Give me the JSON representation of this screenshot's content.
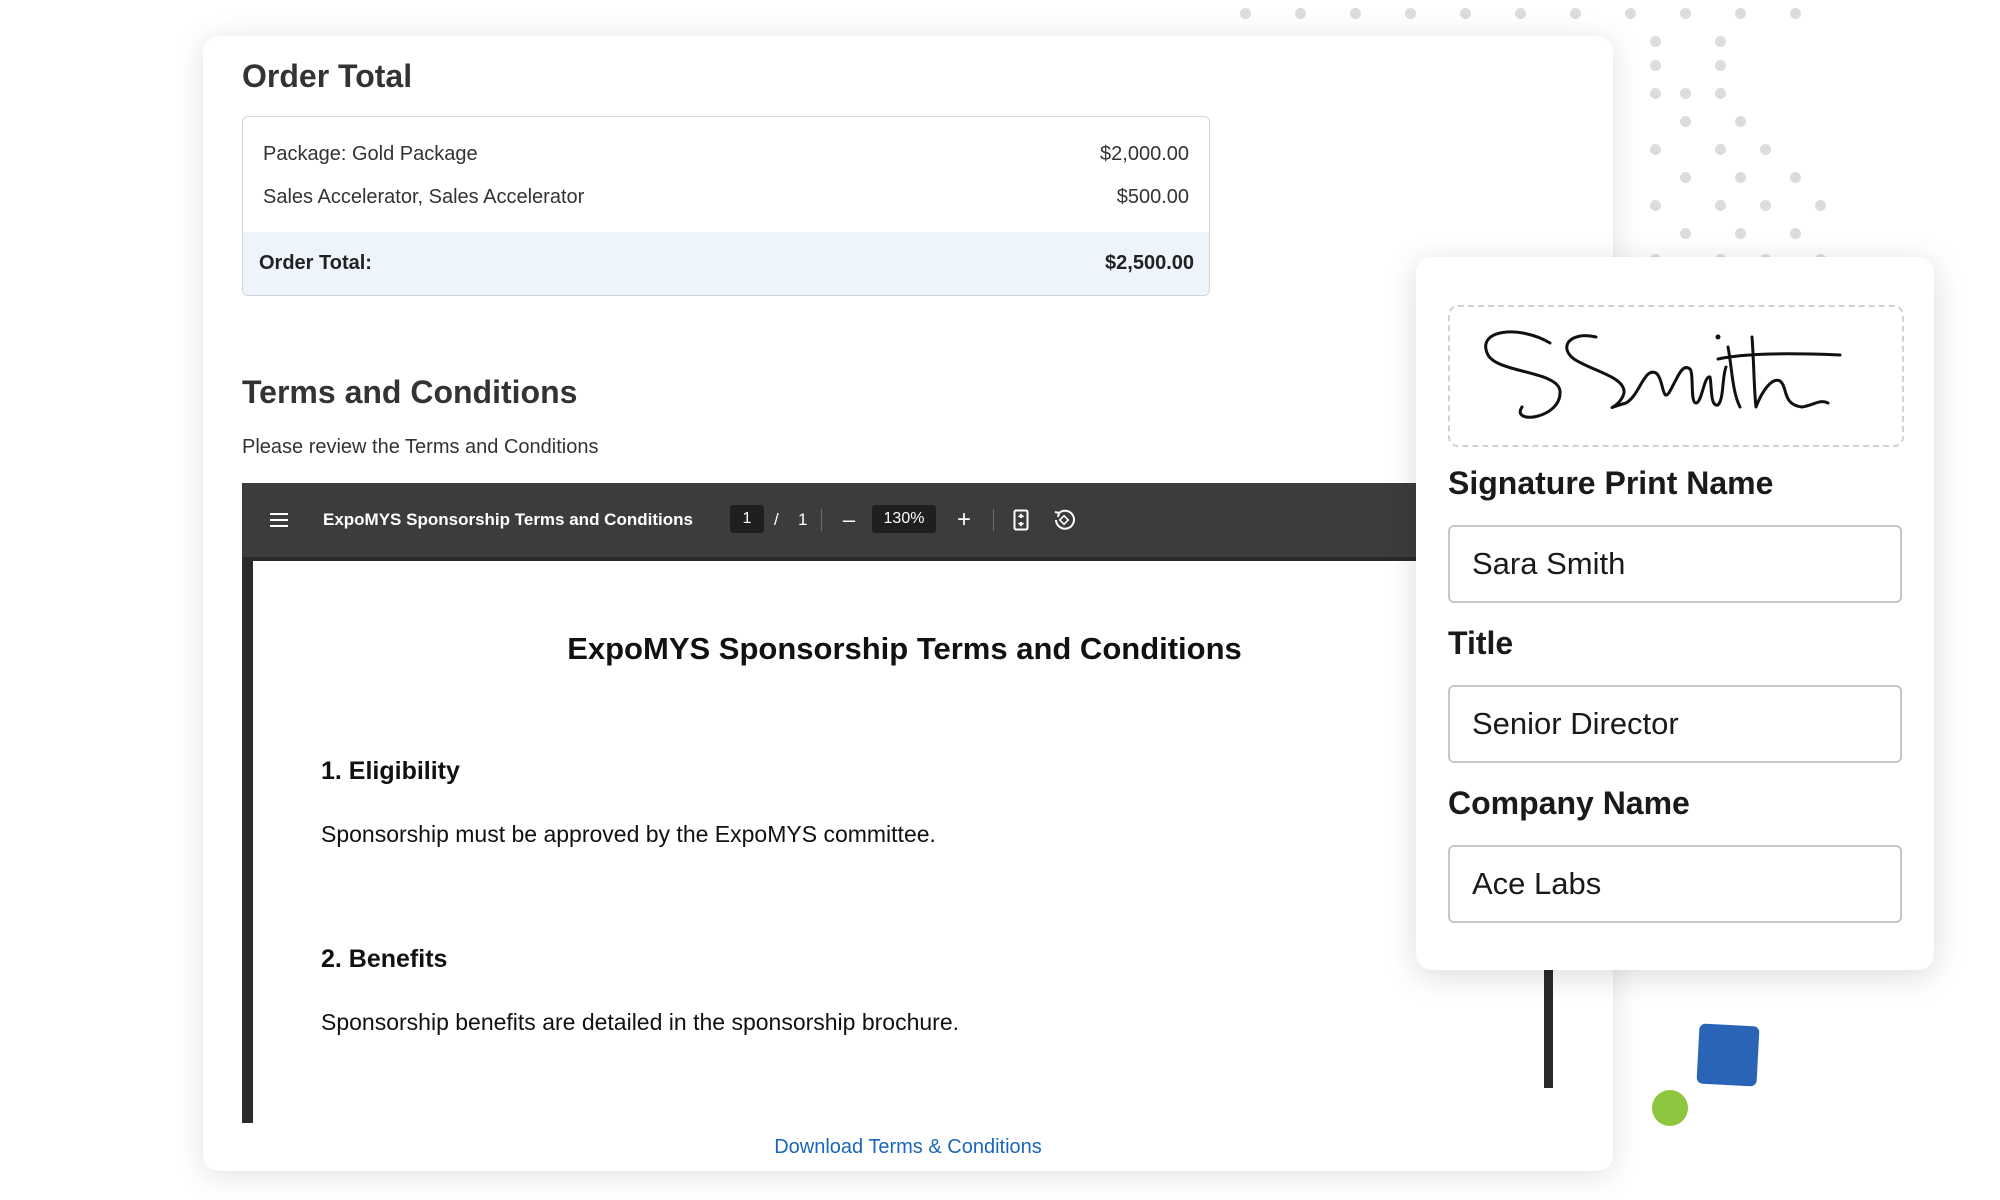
{
  "order": {
    "title": "Order Total",
    "items": [
      {
        "label": "Package: Gold Package",
        "amount": "$2,000.00"
      },
      {
        "label": "Sales Accelerator, Sales Accelerator",
        "amount": "$500.00"
      }
    ],
    "total_label": "Order Total:",
    "total_amount": "$2,500.00"
  },
  "terms": {
    "title": "Terms and Conditions",
    "subtitle": "Please review the Terms and Conditions",
    "download_link": "Download Terms & Conditions"
  },
  "viewer": {
    "doc_title": "ExpoMYS Sponsorship Terms and Conditions",
    "page_current": "1",
    "page_separator": "/",
    "page_total": "1",
    "zoom": "130%",
    "zoom_out_symbol": "–",
    "zoom_in_symbol": "+",
    "icons": [
      "menu-icon",
      "fit-page-icon",
      "rotate-icon"
    ]
  },
  "document": {
    "title": "ExpoMYS Sponsorship Terms and Conditions",
    "sections": [
      {
        "heading": "1. Eligibility",
        "body": "Sponsorship must be approved by the ExpoMYS committee."
      },
      {
        "heading": "2. Benefits",
        "body": "Sponsorship benefits are detailed in the sponsorship brochure."
      }
    ]
  },
  "signature": {
    "signature_text": "SSmith",
    "print_name_label": "Signature Print Name",
    "print_name_value": "Sara Smith",
    "title_label": "Title",
    "title_value": "Senior Director",
    "company_label": "Company Name",
    "company_value": "Ace Labs"
  },
  "colors": {
    "accent_link": "#1a66b8",
    "toolbar_bg": "#3c3c3c",
    "total_row_bg": "#eef4fc",
    "deco_blue": "#2a64b7",
    "deco_green": "#8cc63f"
  }
}
